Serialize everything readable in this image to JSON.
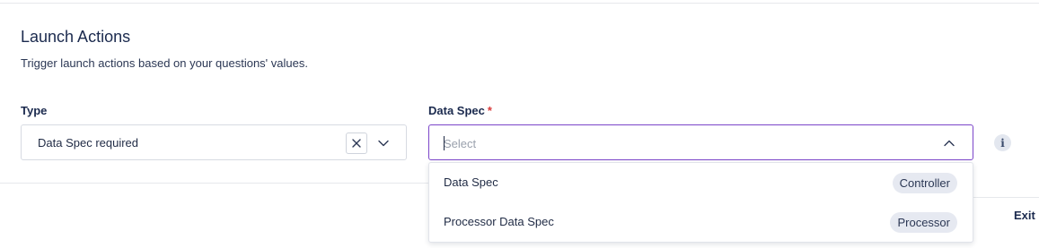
{
  "section": {
    "title": "Launch Actions",
    "description": "Trigger launch actions based on your questions' values."
  },
  "type_field": {
    "label": "Type",
    "value": "Data Spec required"
  },
  "data_spec_field": {
    "label": "Data Spec",
    "required_marker": "*",
    "placeholder": "Select",
    "options": [
      {
        "label": "Data Spec",
        "badge": "Controller"
      },
      {
        "label": "Processor Data Spec",
        "badge": "Processor"
      }
    ]
  },
  "footer": {
    "exit_label": "Exit"
  },
  "colors": {
    "focus_border": "#7b45c9",
    "required": "#d93a3a",
    "badge_bg": "#e6e9f1"
  }
}
